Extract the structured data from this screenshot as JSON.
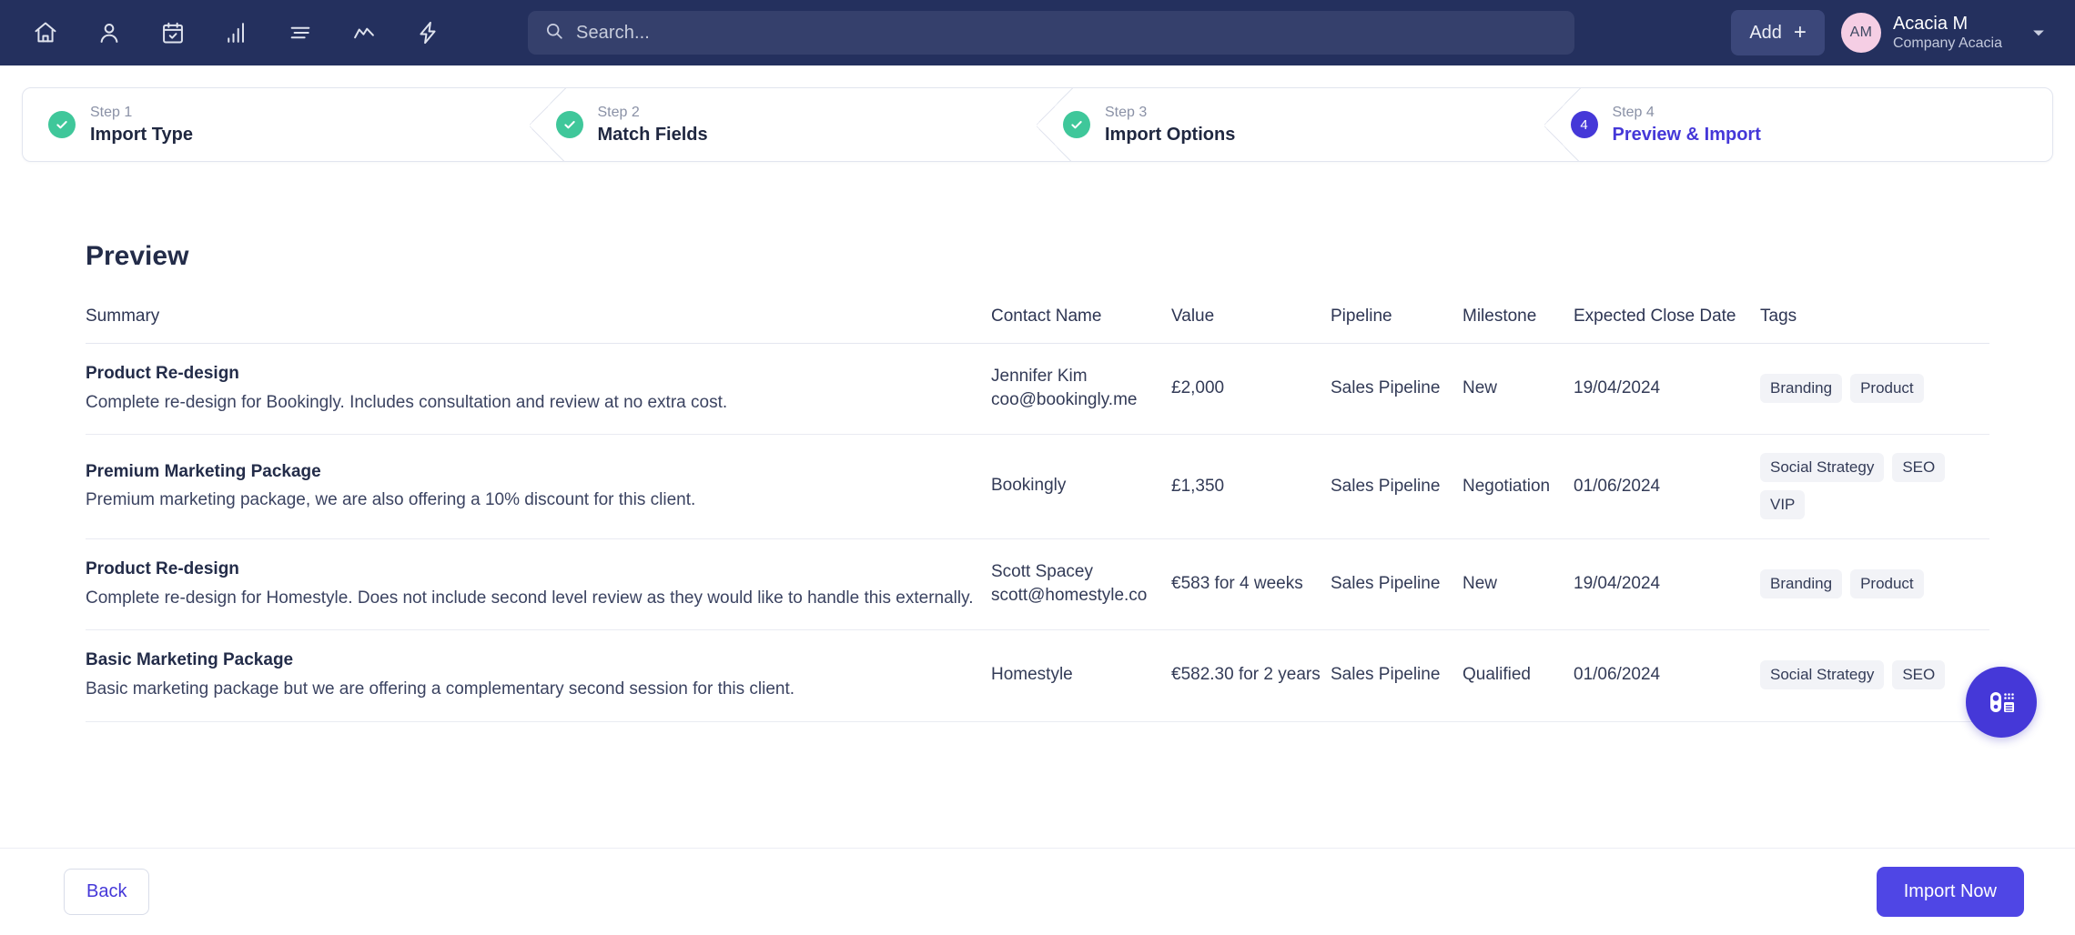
{
  "topnav": {
    "icons": [
      {
        "name": "home-icon"
      },
      {
        "name": "contacts-icon"
      },
      {
        "name": "calendar-check-icon"
      },
      {
        "name": "bar-chart-icon"
      },
      {
        "name": "list-icon"
      },
      {
        "name": "activity-line-icon"
      },
      {
        "name": "lightning-bolt-icon"
      }
    ],
    "search": {
      "placeholder": "Search...",
      "value": "",
      "icon": "search-icon"
    },
    "add_button": {
      "label": "Add",
      "plus": "+"
    },
    "profile": {
      "initials": "AM",
      "name": "Acacia M",
      "company": "Company Acacia"
    },
    "caret": "chevron-down-icon",
    "background_color": "#24305e"
  },
  "stepper": {
    "steps": [
      {
        "num": "Step 1",
        "label": "Import Type",
        "state": "done",
        "mark": "✓"
      },
      {
        "num": "Step 2",
        "label": "Match Fields",
        "state": "done",
        "mark": "✓"
      },
      {
        "num": "Step 3",
        "label": "Import Options",
        "state": "done",
        "mark": "✓"
      },
      {
        "num": "Step 4",
        "label": "Preview & Import",
        "state": "active",
        "mark": "4"
      }
    ],
    "done_color": "#3fc79a",
    "active_color": "#4538d8"
  },
  "main": {
    "title": "Preview",
    "columns": [
      "Summary",
      "Contact Name",
      "Value",
      "Pipeline",
      "Milestone",
      "Expected Close Date",
      "Tags"
    ],
    "rows": [
      {
        "summary_title": "Product Re-design",
        "summary_desc": "Complete re-design for Bookingly. Includes consultation and review at no extra cost.",
        "contact_name": "Jennifer Kim",
        "contact_email": "coo@bookingly.me",
        "value": "£2,000",
        "pipeline": "Sales Pipeline",
        "milestone": "New",
        "close_date": "19/04/2024",
        "tags": [
          "Branding",
          "Product"
        ]
      },
      {
        "summary_title": "Premium Marketing Package",
        "summary_desc": "Premium marketing package, we are also offering a 10% discount for this client.",
        "contact_name": "Bookingly",
        "contact_email": "",
        "value": "£1,350",
        "pipeline": "Sales Pipeline",
        "milestone": "Negotiation",
        "close_date": "01/06/2024",
        "tags": [
          "Social Strategy",
          "SEO",
          "VIP"
        ]
      },
      {
        "summary_title": "Product Re-design",
        "summary_desc": "Complete re-design for Homestyle. Does not include second level review as they would like to handle this externally.",
        "contact_name": "Scott Spacey",
        "contact_email": "scott@homestyle.co",
        "value": "€583 for 4 weeks",
        "pipeline": "Sales Pipeline",
        "milestone": "New",
        "close_date": "19/04/2024",
        "tags": [
          "Branding",
          "Product"
        ]
      },
      {
        "summary_title": "Basic Marketing Package",
        "summary_desc": "Basic marketing package but we are offering a complementary second session for this client.",
        "contact_name": "Homestyle",
        "contact_email": "",
        "value": "€582.30 for 2 years",
        "pipeline": "Sales Pipeline",
        "milestone": "Qualified",
        "close_date": "01/06/2024",
        "tags": [
          "Social Strategy",
          "SEO"
        ]
      }
    ]
  },
  "footer": {
    "back_label": "Back",
    "import_label": "Import Now",
    "import_color": "#4f46e5"
  },
  "fab": {
    "icon": "intercom-device-icon",
    "color": "#4538d8"
  }
}
